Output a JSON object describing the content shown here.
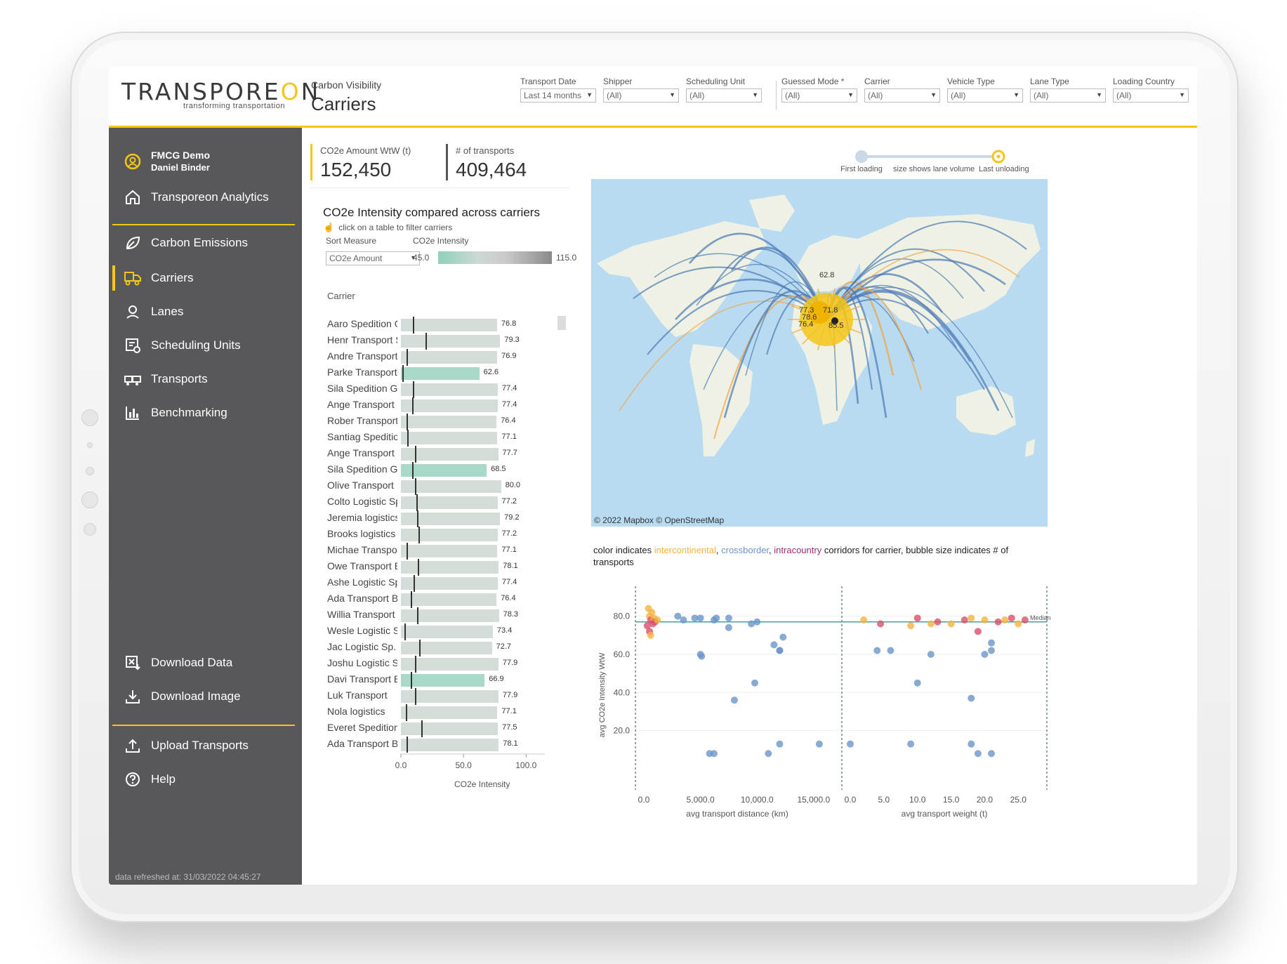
{
  "header": {
    "logo_left": "TRANSPORE",
    "logo_accent": "O",
    "logo_right": "N",
    "tagline": "transforming transportation",
    "breadcrumb": "Carbon Visibility",
    "title": "Carriers",
    "filters": [
      {
        "label": "Transport Date",
        "value": "Last 14 months"
      },
      {
        "label": "Shipper",
        "value": "(All)"
      },
      {
        "label": "Scheduling Unit",
        "value": "(All)"
      },
      {
        "label": "Guessed Mode *",
        "value": "(All)"
      },
      {
        "label": "Carrier",
        "value": "(All)"
      },
      {
        "label": "Vehicle Type",
        "value": "(All)"
      },
      {
        "label": "Lane Type",
        "value": "(All)"
      },
      {
        "label": "Loading Country",
        "value": "(All)"
      }
    ]
  },
  "sidebar": {
    "user": {
      "org": "FMCG Demo",
      "name": "Daniel Binder"
    },
    "home": "Transporeon Analytics",
    "items": [
      {
        "label": "Carbon Emissions",
        "icon": "leaf-icon"
      },
      {
        "label": "Carriers",
        "icon": "truck-icon"
      },
      {
        "label": "Lanes",
        "icon": "pin-icon"
      },
      {
        "label": "Scheduling Units",
        "icon": "schedule-icon"
      },
      {
        "label": "Transports",
        "icon": "transports-icon"
      },
      {
        "label": "Benchmarking",
        "icon": "bar-chart-icon"
      }
    ],
    "download_data": "Download Data",
    "download_image": "Download Image",
    "upload": "Upload Transports",
    "help": "Help",
    "refreshed": "data refreshed at: 31/03/2022 04:45:27"
  },
  "kpis": [
    {
      "label": "CO2e Amount WtW (t)",
      "value": "152,450"
    },
    {
      "label": "# of transports",
      "value": "409,464"
    }
  ],
  "intensity_panel": {
    "title": "CO2e Intensity compared across carriers",
    "hint": "click on a table to filter carriers",
    "sort_label": "Sort Measure",
    "sort_value": "CO2e Amount",
    "legend_label": "CO2e Intensity",
    "legend_min": "45.0",
    "legend_max": "115.0",
    "column_header": "Carrier"
  },
  "chart_data": [
    {
      "type": "bar",
      "title": "CO2e Intensity compared across carriers",
      "xlabel": "CO2e Intensity",
      "ylabel": "Carrier",
      "xlim": [
        0,
        115
      ],
      "xticks": [
        "0.0",
        "50.0",
        "100.0"
      ],
      "categories": [
        "Aaro Spedition Gr",
        "Henr Transport S",
        "Andre Transport",
        "Parke Transport L",
        "Sila Spedition Gm",
        "Ange Transport L",
        "Rober Transport I",
        "Santiag Spedition",
        "Ange Transport L",
        "Sila Spedition Gm",
        "Olive Transport B",
        "Colto Logistic Sp.",
        "Jeremia logistics",
        "Brooks logistics",
        "Michae Transport",
        "Owe Transport B.",
        "Ashe Logistic Sp.",
        "Ada Transport B.V",
        "Willia Transport",
        "Wesle Logistic Sp",
        "Jac Logistic Sp. z",
        "Joshu Logistic Sp",
        "Davi Transport B.",
        "Luk Transport",
        "Nola logistics",
        "Everet Spedition",
        "Ada Transport B.V"
      ],
      "values": [
        76.8,
        79.3,
        76.9,
        62.6,
        77.4,
        77.4,
        76.4,
        77.1,
        77.7,
        68.5,
        80.0,
        77.2,
        79.2,
        77.2,
        77.1,
        78.1,
        77.4,
        76.4,
        78.3,
        73.4,
        72.7,
        77.9,
        66.9,
        77.9,
        77.1,
        77.5,
        78.1
      ],
      "value_labels": [
        "76.8",
        "79.3",
        "76.9",
        "62.6",
        "77.4",
        "77.4",
        "76.4",
        "77.1",
        "77.7",
        "68.5",
        "80.0",
        "77.2",
        "79.2",
        "77.2",
        "77.1",
        "78.1",
        "77.4",
        "76.4",
        "78.3",
        "73.4",
        "72.7",
        "77.9",
        "66.9",
        "77.9",
        "77.1",
        "77.5",
        "78.1"
      ],
      "medians": [
        17,
        35,
        8,
        2,
        17,
        16,
        8,
        9,
        20,
        16,
        20,
        22,
        23,
        25,
        8,
        24,
        18,
        14,
        23,
        5,
        26,
        20,
        14,
        20,
        7,
        29,
        8
      ],
      "colors": {
        "low": "#a8d8c8",
        "high": "#d5ddd9"
      }
    },
    {
      "type": "scatter",
      "title": "color indicates intercontinental, crossborder, intracountry corridors for carrier, bubble size indicates # of transports",
      "ylabel": "avg CO2e Intensity WtW",
      "ylim": [
        0,
        92
      ],
      "yticks": [
        "20.0",
        "40.0",
        "60.0",
        "80.0"
      ],
      "median_line": 77,
      "median_label": "Median",
      "panels": [
        {
          "xlabel": "avg transport distance (km)",
          "xlim": [
            0,
            16500
          ],
          "xticks": [
            "0.0",
            "5,000.0",
            "10,000.0",
            "15,000.0"
          ],
          "tick_values": [
            0,
            5000,
            10000,
            15000
          ],
          "points": [
            [
              500,
              80
            ],
            [
              600,
              78
            ],
            [
              700,
              82
            ],
            [
              800,
              76
            ],
            [
              900,
              79
            ],
            [
              1000,
              77
            ],
            [
              1200,
              78
            ],
            [
              300,
              75
            ],
            [
              400,
              84
            ],
            [
              500,
              72
            ],
            [
              600,
              70
            ],
            [
              3000,
              80
            ],
            [
              3500,
              78
            ],
            [
              4500,
              79
            ],
            [
              5000,
              79
            ],
            [
              6200,
              78
            ],
            [
              6400,
              79
            ],
            [
              7500,
              79
            ],
            [
              7500,
              74
            ],
            [
              9500,
              76
            ],
            [
              10000,
              77
            ],
            [
              5000,
              60
            ],
            [
              5100,
              59
            ],
            [
              11500,
              65
            ],
            [
              12000,
              62
            ],
            [
              12300,
              69
            ],
            [
              12000,
              62
            ],
            [
              9800,
              45
            ],
            [
              8000,
              36
            ],
            [
              5800,
              8
            ],
            [
              6200,
              8
            ],
            [
              11000,
              8
            ],
            [
              12000,
              13
            ],
            [
              15500,
              13
            ]
          ]
        },
        {
          "xlabel": "avg transport weight (t)",
          "xlim": [
            0,
            28
          ],
          "xticks": [
            "0.0",
            "5.0",
            "10.0",
            "15.0",
            "20.0",
            "25.0"
          ],
          "tick_values": [
            0,
            5,
            10,
            15,
            20,
            25
          ],
          "points": [
            [
              2,
              78
            ],
            [
              4.5,
              76
            ],
            [
              4,
              62
            ],
            [
              6,
              62
            ],
            [
              9,
              75
            ],
            [
              10,
              79
            ],
            [
              12,
              76
            ],
            [
              13,
              77
            ],
            [
              15,
              76
            ],
            [
              17,
              78
            ],
            [
              18,
              79
            ],
            [
              19,
              72
            ],
            [
              20,
              78
            ],
            [
              22,
              77
            ],
            [
              23,
              78
            ],
            [
              24,
              79
            ],
            [
              25,
              76
            ],
            [
              26,
              78
            ],
            [
              12,
              60
            ],
            [
              20,
              60
            ],
            [
              21,
              66
            ],
            [
              21,
              62
            ],
            [
              10,
              45
            ],
            [
              18,
              37
            ],
            [
              9,
              13
            ],
            [
              18,
              13
            ],
            [
              19,
              8
            ],
            [
              21,
              8
            ],
            [
              0,
              13
            ]
          ]
        }
      ],
      "series_colors": {
        "intercontinental": "#f5b340",
        "crossborder": "#6b96c8",
        "intracountry": "#d94f6a"
      }
    }
  ],
  "map": {
    "slider_left": "First loading",
    "slider_mid": "size shows lane volume",
    "slider_right": "Last unloading",
    "attribution": "© 2022 Mapbox  © OpenStreetMap",
    "labels": [
      "62.8",
      "77.3",
      "78.6",
      "76.4",
      "85.5",
      "71.8"
    ]
  },
  "scatter_legend": {
    "prefix": "color indicates ",
    "intercontinental": "intercontinental",
    "comma1": ", ",
    "crossborder": "crossborder",
    "comma2": ", ",
    "intracountry": "intracountry",
    "suffix": " corridors for carrier, bubble size indicates # of transports"
  }
}
